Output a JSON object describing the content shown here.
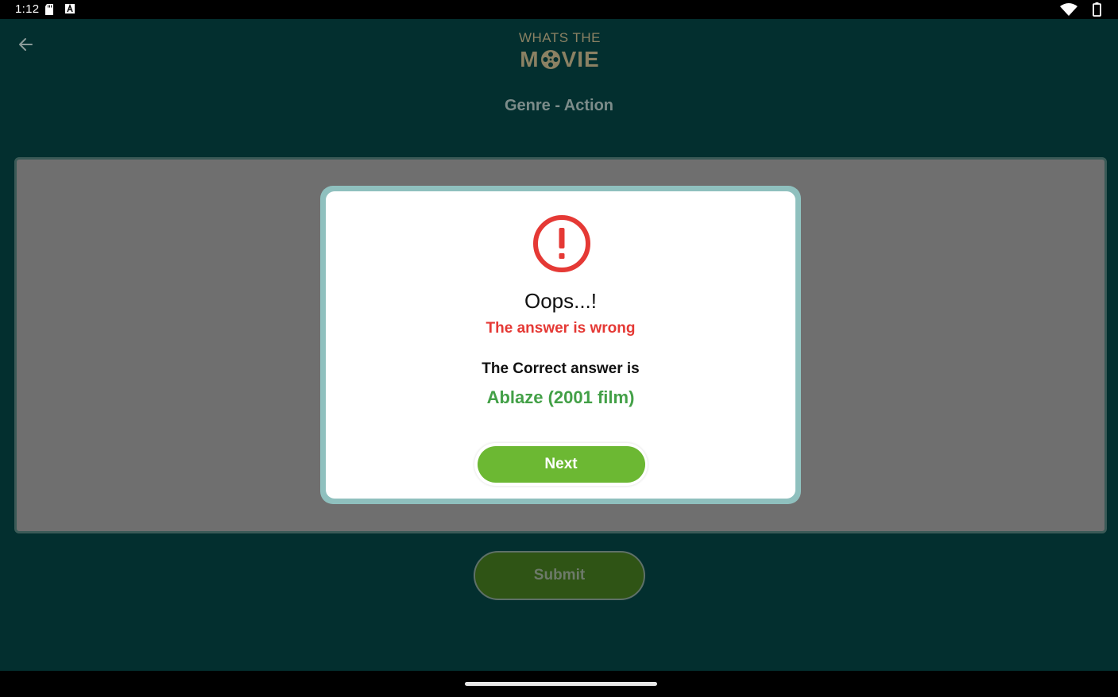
{
  "status_bar": {
    "time": "1:12"
  },
  "header": {
    "logo_top": "WHATS THE",
    "logo_bottom_left": "M",
    "logo_bottom_right": "VIE",
    "genre_title": "Genre - Action"
  },
  "main": {
    "submit_label": "Submit"
  },
  "dialog": {
    "title": "Oops...!",
    "subtitle": "The answer is wrong",
    "correct_label": "The Correct answer is",
    "correct_answer": "Ablaze (2001 film)",
    "next_label": "Next"
  },
  "colors": {
    "app_background": "#032f2f",
    "error_red": "#e53935",
    "answer_green": "#43a047",
    "next_button_green": "#6cb833",
    "logo_gold": "#8b8163"
  },
  "icons": {
    "back": "arrow-left-icon",
    "alert": "exclamation-circle-icon",
    "logo_reel": "film-reel-icon"
  }
}
